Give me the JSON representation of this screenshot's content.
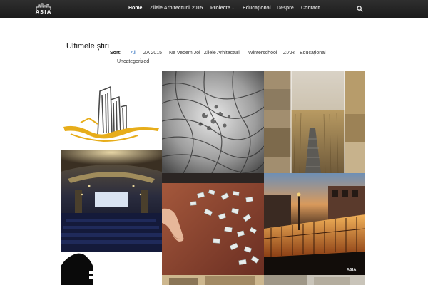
{
  "logo": {
    "text": "ASIA",
    "icon": "skyline-logo-icon"
  },
  "nav": {
    "items": [
      {
        "label": "Home",
        "active": true
      },
      {
        "label": "Zilele Arhitecturii 2015"
      },
      {
        "label": "Proiecte",
        "caret": "⌄"
      },
      {
        "label": "Educațional"
      },
      {
        "label": "Despre"
      },
      {
        "label": "Contact"
      }
    ],
    "search_icon": "search-icon"
  },
  "section": {
    "title": "Ultimele știri"
  },
  "filters": {
    "label": "Sort:",
    "items": [
      {
        "label": "All",
        "active": true
      },
      {
        "label": "ZA 2015"
      },
      {
        "label": "Ne Vedem Joi"
      },
      {
        "label": "Zilele Arhitecturii"
      },
      {
        "label": "Winterschool"
      },
      {
        "label": "ZIAR"
      },
      {
        "label": "Educațional"
      },
      {
        "label": "Uncategorized"
      }
    ]
  },
  "colors": {
    "nav_bg": "#1f1f1f",
    "active_filter": "#3b78c2",
    "logo_yellow": "#e7ad1a"
  },
  "tiles": [
    {
      "id": "tile-za-logo",
      "kind": "building logo illustration"
    },
    {
      "id": "tile-parametric",
      "kind": "parametric facade photo"
    },
    {
      "id": "tile-boardwalk",
      "kind": "reed boardwalk collage"
    },
    {
      "id": "tile-cinema",
      "kind": "cinema hall photo"
    },
    {
      "id": "tile-puzzle",
      "kind": "puzzle pieces on table photo"
    },
    {
      "id": "tile-night-building",
      "kind": "night building photo"
    },
    {
      "id": "tile-black-silhouette",
      "kind": "black silhouette graphic"
    },
    {
      "id": "tile-bottom-building",
      "kind": "building photo"
    },
    {
      "id": "tile-bottom-asia",
      "kind": "asia badge photo"
    }
  ]
}
